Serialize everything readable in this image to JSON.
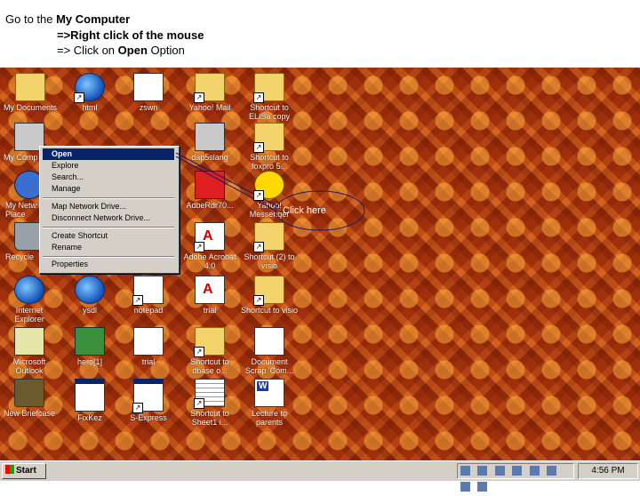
{
  "instructions": {
    "line1_prefix": "Go to the ",
    "line1_bold": "My Computer",
    "line2": "=>Right click of the mouse",
    "line3_prefix": "=> Click on ",
    "line3_bold": "Open",
    "line3_suffix": " Option"
  },
  "desktop_icons": {
    "my_documents": "My Documents",
    "html": "html",
    "zswn": "zswn",
    "yahoo_mail": "Yahoo! Mail",
    "shortcut_elisa": "Shortcut to ELISa copy",
    "my_computer": "My Comp",
    "dap_slang": "dap5slang",
    "shortcut_foxpro": "Shortcut to foxpro 5...",
    "network": "My Netw... Place",
    "adobe_reader": "AdbeRdr70...",
    "yahoo_messenger": "Yahoo! Messenger",
    "recycle_bin": "Recycle",
    "adobe_acrobat": "Adobe Acrobat 4.0",
    "shortcut_2_visio": "Shortcut (2) to visio",
    "internet_explorer": "Internet Explorer",
    "ysdl": "ysdl",
    "notepad": "notepad",
    "trial_pdf": "trial",
    "shortcut_visio": "Shortcut to visio",
    "outlook": "Microsoft Outlook",
    "hero": "hero[1]",
    "trial": "trial",
    "shortcut_dbase": "Shortcut to dbase o...",
    "document_scrap": "Document Scrap 'Com...",
    "briefcase": "New Briefcase",
    "fixkez": "FixKez",
    "s_express": "S-Express",
    "shortcut_sheet": "Shortcut to Sheet1 i...",
    "lecture": "Lecture to parents"
  },
  "context_menu": {
    "open": "Open",
    "explore": "Explore",
    "search": "Search...",
    "manage": "Manage",
    "map_drive": "Map Network Drive...",
    "disconnect_drive": "Disconnect Network Drive...",
    "create_shortcut": "Create Shortcut",
    "rename": "Rename",
    "properties": "Properties"
  },
  "callout": "Click here",
  "taskbar": {
    "start": "Start",
    "clock": "4:56 PM"
  }
}
